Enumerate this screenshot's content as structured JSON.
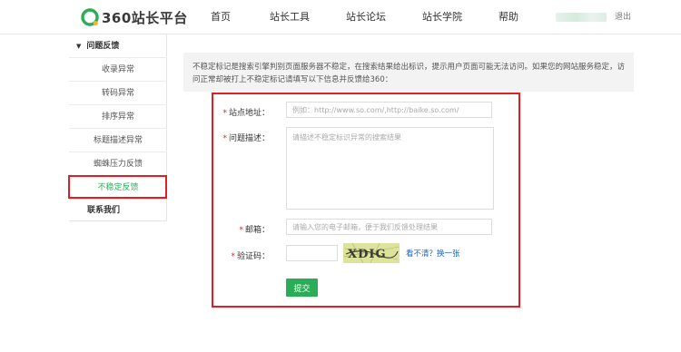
{
  "header": {
    "logo_text": "360站长平台",
    "nav": [
      "首页",
      "站长工具",
      "站长论坛",
      "站长学院",
      "帮助"
    ],
    "logout": "退出"
  },
  "sidebar": {
    "section_title": "问题反馈",
    "items": [
      "收录异常",
      "转码异常",
      "排序异常",
      "标题描述异常",
      "蜘蛛压力反馈",
      "不稳定反馈"
    ],
    "active_item": "不稳定反馈",
    "contact": "联系我们"
  },
  "notice": {
    "text": "不稳定标记是搜索引擎判别页面服务器不稳定，在搜索结果给出标识，提示用户页面可能无法访问。如果您的网站服务稳定，访问正常却被打上不稳定标记请填写以下信息并反馈给360："
  },
  "form": {
    "required_mark": "*",
    "site_label": "站点地址：",
    "site_placeholder": "例如：http://www.so.com/,http://baike.so.com/",
    "desc_label": "问题描述：",
    "desc_placeholder": "请描述不稳定标识异常的搜索结果",
    "email_label": "邮箱：",
    "email_placeholder": "请输入您的电子邮箱，便于我们反馈处理结果",
    "captcha_label": "验证码：",
    "captcha_text": "XDIG",
    "refresh_link": "看不清？换一张",
    "submit_label": "提交"
  },
  "colors": {
    "brand_green": "#2bac57",
    "highlight_red": "#e02020",
    "link_blue": "#1a64c8"
  }
}
